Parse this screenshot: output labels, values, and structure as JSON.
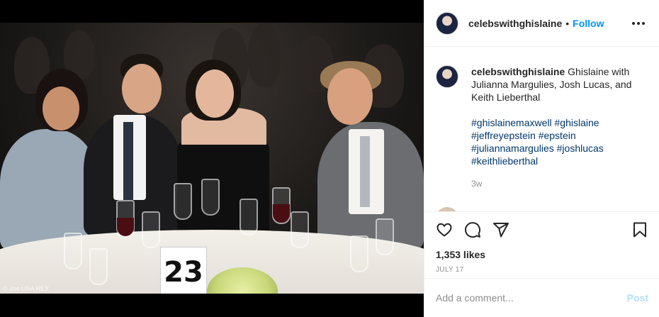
{
  "post": {
    "username": "celebswithghislaine",
    "follow_label": "Follow",
    "separator": "•",
    "caption_text": "Ghislaine with Julianna Margulies, Josh Lucas, and Keith Lieberthal",
    "hashtags": [
      "#ghislainemaxwell",
      "#ghislaine",
      "#jeffreyepstein",
      "#epstein",
      "#juliannamargulies",
      "#joshlucas",
      "#keithlieberthal"
    ],
    "time_ago": "3w",
    "likes": "1,353 likes",
    "date": "JULY 17"
  },
  "photo": {
    "table_number": "23",
    "credit": "© Joe USA REX"
  },
  "comment_box": {
    "placeholder": "Add a comment...",
    "post_label": "Post"
  },
  "icons": [
    "more-icon",
    "heart-icon",
    "comment-icon",
    "share-icon",
    "bookmark-icon"
  ],
  "colors": {
    "link_blue": "#0095f6",
    "hashtag": "#00376b",
    "muted": "#8e8e8e",
    "post_disabled": "#b2dffc"
  }
}
